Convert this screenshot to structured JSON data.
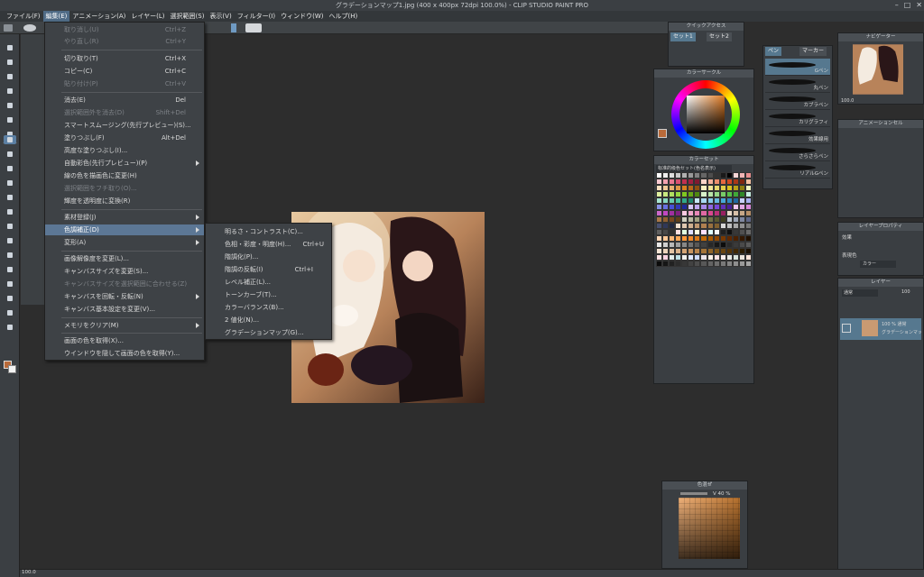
{
  "window": {
    "title": "グラデーションマップ1.jpg (400 x 400px 72dpi 100.0%)  - CLIP STUDIO PAINT PRO",
    "controls": [
      "minimize-icon",
      "maximize-icon",
      "close-icon"
    ]
  },
  "menubar": {
    "items": [
      {
        "label": "ファイル(F)"
      },
      {
        "label": "編集(E)"
      },
      {
        "label": "アニメーション(A)"
      },
      {
        "label": "レイヤー(L)"
      },
      {
        "label": "選択範囲(S)"
      },
      {
        "label": "表示(V)"
      },
      {
        "label": "フィルター(I)"
      },
      {
        "label": "ウィンドウ(W)"
      },
      {
        "label": "ヘルプ(H)"
      }
    ],
    "active_index": 1
  },
  "edit_menu": {
    "items": [
      {
        "label": "取り消し(U)",
        "shortcut": "Ctrl+Z",
        "disabled": true
      },
      {
        "label": "やり直し(R)",
        "shortcut": "Ctrl+Y",
        "disabled": true
      },
      {
        "label": "切り取り(T)",
        "shortcut": "Ctrl+X",
        "disabled": false
      },
      {
        "label": "コピー(C)",
        "shortcut": "Ctrl+C",
        "disabled": false
      },
      {
        "label": "貼り付け(P)",
        "shortcut": "Ctrl+V",
        "disabled": true
      },
      {
        "label": "消去(E)",
        "shortcut": "Del",
        "disabled": false
      },
      {
        "label": "選択範囲外を消去(D)",
        "shortcut": "Shift+Del",
        "disabled": true
      },
      {
        "label": "スマートスムージング(先行プレビュー)(S)...",
        "shortcut": "",
        "disabled": false
      },
      {
        "label": "塗りつぶし(F)",
        "shortcut": "Alt+Del",
        "disabled": false
      },
      {
        "label": "高度な塗りつぶし(I)...",
        "shortcut": "",
        "disabled": false
      },
      {
        "label": "自動彩色(先行プレビュー)(P)",
        "shortcut": "",
        "disabled": false,
        "submenu": true
      },
      {
        "label": "線の色を描画色に変更(H)",
        "shortcut": "",
        "disabled": false
      },
      {
        "label": "選択範囲をフチ取り(O)...",
        "shortcut": "",
        "disabled": true
      },
      {
        "label": "輝度を透明度に変換(R)",
        "shortcut": "",
        "disabled": false
      },
      {
        "label": "素材登録(J)",
        "shortcut": "",
        "disabled": false,
        "submenu": true
      },
      {
        "label": "色調補正(D)",
        "shortcut": "",
        "disabled": false,
        "submenu": true,
        "highlighted": true
      },
      {
        "label": "変形(A)",
        "shortcut": "",
        "disabled": false,
        "submenu": true
      },
      {
        "label": "画像解像度を変更(L)...",
        "shortcut": "",
        "disabled": false
      },
      {
        "label": "キャンバスサイズを変更(S)...",
        "shortcut": "",
        "disabled": false
      },
      {
        "label": "キャンバスサイズを選択範囲に合わせる(Z)",
        "shortcut": "",
        "disabled": true
      },
      {
        "label": "キャンバスを回転・反転(N)",
        "shortcut": "",
        "disabled": false,
        "submenu": true
      },
      {
        "label": "キャンバス基本設定を変更(V)...",
        "shortcut": "",
        "disabled": false
      },
      {
        "label": "メモリをクリア(M)",
        "shortcut": "",
        "disabled": false,
        "submenu": true
      },
      {
        "label": "画面の色を取得(X)...",
        "shortcut": "",
        "disabled": false
      },
      {
        "label": "ウインドウを隠して画面の色を取得(Y)...",
        "shortcut": "",
        "disabled": false
      }
    ]
  },
  "color_correction_submenu": {
    "items": [
      {
        "label": "明るさ・コントラスト(C)...",
        "shortcut": ""
      },
      {
        "label": "色相・彩度・明度(H)...",
        "shortcut": "Ctrl+U"
      },
      {
        "label": "階調化(P)...",
        "shortcut": ""
      },
      {
        "label": "階調の反転(I)",
        "shortcut": "Ctrl+I"
      },
      {
        "label": "レベル補正(L)...",
        "shortcut": ""
      },
      {
        "label": "トーンカーブ(T)...",
        "shortcut": ""
      },
      {
        "label": "カラーバランス(B)...",
        "shortcut": ""
      },
      {
        "label": "2 値化(N)...",
        "shortcut": ""
      },
      {
        "label": "グラデーションマップ(G)...",
        "shortcut": ""
      }
    ]
  },
  "panels": {
    "quick_access": {
      "title": "クイックアクセス",
      "tabs": [
        "セット1",
        "セット2"
      ]
    },
    "color_wheel": {
      "title": "カラーサークル"
    },
    "color_set": {
      "title": "カラーセット",
      "selector": "标准的级色セット(色名表示)"
    },
    "brush": {
      "tabs": [
        "ペン",
        "マーカー"
      ],
      "items": [
        "Gペン",
        "丸ペン",
        "カブラペン",
        "カリグラフィ",
        "効果線用",
        "さらさらペン",
        "リアルGペン"
      ]
    },
    "navigator": {
      "title": "ナビゲーター",
      "zoom": "100.0"
    },
    "animation_cels": {
      "title": "アニメーションセル"
    },
    "layer_property": {
      "title": "レイヤープロパティ",
      "effect_label": "効果",
      "display_color_label": "表現色",
      "display_color_value": "カラー"
    },
    "layers": {
      "title": "レイヤー",
      "blend": "通常",
      "opacity": "100",
      "layer_name_1": "100 % 通常",
      "layer_name_2": "グラデーションマップ1"
    },
    "color_mixer": {
      "title": "色混ぜ",
      "value_label": "V 40 %"
    }
  },
  "status": {
    "zoom": "100.0"
  },
  "palette_colors": [
    "#ffffff",
    "#eeeeee",
    "#dddddd",
    "#c8c8c8",
    "#b0b0b0",
    "#999999",
    "#808080",
    "#666666",
    "#4d4d4d",
    "#333333",
    "#1a1a1a",
    "#000000",
    "#f7d7d7",
    "#f1b5b5",
    "#e88f8f",
    "#f8c8d0",
    "#f2a0b0",
    "#e87890",
    "#d85070",
    "#c03050",
    "#a02040",
    "#801830",
    "#f9d4c8",
    "#f3b09a",
    "#ec8c6c",
    "#e46840",
    "#d04820",
    "#a83818",
    "#802810",
    "#f4c0a0",
    "#f8e0c0",
    "#f0c898",
    "#e8b070",
    "#e09848",
    "#d88020",
    "#b86818",
    "#905010",
    "#f8f0c0",
    "#f0e498",
    "#e8d870",
    "#e0cc48",
    "#d8c020",
    "#b8a018",
    "#908010",
    "#f0f8c0",
    "#e0f0a0",
    "#c8e880",
    "#b0e060",
    "#98d840",
    "#80c820",
    "#68a818",
    "#508810",
    "#d8f0c8",
    "#b8e4a8",
    "#98d888",
    "#78cc68",
    "#58c048",
    "#40a838",
    "#308828",
    "#c8f0e0",
    "#a8e4d0",
    "#88d8c0",
    "#68ccb0",
    "#48c0a0",
    "#30a888",
    "#208870",
    "#c8e8f8",
    "#a8d8f0",
    "#88c8e8",
    "#68b8e0",
    "#48a8d8",
    "#3088c0",
    "#2068a0",
    "#c8d0f8",
    "#a8b0f0",
    "#8890e8",
    "#6870e0",
    "#4850d8",
    "#3038b8",
    "#202898",
    "#d8c8f8",
    "#c0a8f0",
    "#a888e8",
    "#9068e0",
    "#7848d8",
    "#6030b8",
    "#482098",
    "#f0c8f0",
    "#e4a8e4",
    "#d888d8",
    "#cc68cc",
    "#c048c0",
    "#a030a0",
    "#802080",
    "#f8c8e0",
    "#f0a8cc",
    "#e888b8",
    "#e068a4",
    "#d84890",
    "#b83078",
    "#982060",
    "#e8d8c8",
    "#d8c0a8",
    "#c8a888",
    "#b89068",
    "#a87848",
    "#906030",
    "#784820",
    "#604018",
    "#d0d0c0",
    "#b8b8a0",
    "#a0a080",
    "#888860",
    "#707048",
    "#585830",
    "#404020",
    "#c0c8d0",
    "#a0a8b8",
    "#8088a0",
    "#606888",
    "#484f70",
    "#303858",
    "#202840",
    "#f0e0d0",
    "#e0c8b0",
    "#d0b090",
    "#c09870",
    "#b08050",
    "#987040",
    "#806030",
    "#d8d8d8",
    "#c0c0c0",
    "#a8a8a8",
    "#909090",
    "#787878",
    "#606060",
    "#484848",
    "#303030",
    "#ffe0e0",
    "#e0ffe0",
    "#e0e0ff",
    "#ffffe0",
    "#ffe0ff",
    "#e0ffff",
    "#f8f8f8",
    "#202020",
    "#101010",
    "#383838",
    "#505050",
    "#686868",
    "#ffd8b8",
    "#ffc898",
    "#ffb878",
    "#ffa858",
    "#ff9838",
    "#f08828",
    "#d87818",
    "#c06808",
    "#a85800",
    "#904800",
    "#783800",
    "#602800",
    "#4a2000",
    "#341800",
    "#201000",
    "#e8e8e8",
    "#d0d0d0",
    "#b8b8b8",
    "#a0a0a0",
    "#888888",
    "#707070",
    "#585858",
    "#404040",
    "#282828",
    "#181818",
    "#0c0c0c",
    "#2a2a2a",
    "#3a3a3a",
    "#4a4a4a",
    "#5a5a5a",
    "#f4e4d4",
    "#ecd4bc",
    "#e4c4a4",
    "#dcb48c",
    "#d4a474",
    "#c89460",
    "#b8844c",
    "#a47438",
    "#906428",
    "#7c5418",
    "#684410",
    "#543408",
    "#402804",
    "#2c1c00",
    "#1c1000",
    "#fde2e4",
    "#fad2e1",
    "#e2ece9",
    "#bee1e6",
    "#f0efeb",
    "#dfe7fd",
    "#cddafd",
    "#eae4e9",
    "#fff1e6",
    "#fde2e4",
    "#f8edeb",
    "#e8e8e4",
    "#d8e2dc",
    "#ece4db",
    "#ffe5d9",
    "#0b0b0b",
    "#161616",
    "#212121",
    "#2c2c2c",
    "#373737",
    "#424242",
    "#4d4d4d",
    "#585858",
    "#636363",
    "#6e6e6e",
    "#797979",
    "#848484",
    "#8f8f8f",
    "#9a9a9a",
    "#a5a5a5"
  ]
}
